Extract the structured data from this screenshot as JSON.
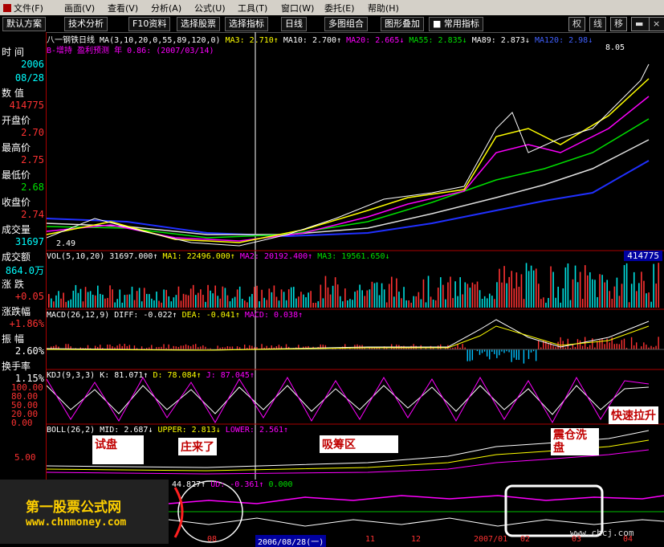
{
  "menu": [
    "文件(F)",
    "画面(V)",
    "查看(V)",
    "分析(A)",
    "公式(U)",
    "工具(T)",
    "窗口(W)",
    "委托(E)",
    "帮助(H)"
  ],
  "toolbar": {
    "buttons": [
      "默认方案",
      "技术分析",
      "F10资料",
      "选择股票",
      "选择指标",
      "日线",
      "多图组合",
      "图形叠加",
      "常用指标"
    ],
    "right": [
      "权",
      "线",
      "移"
    ]
  },
  "left_panel": {
    "time_label": "时  间",
    "year": "2006",
    "date": "08/28",
    "value_label": "数  值",
    "value": "414775",
    "open_label": "开盘价",
    "open": "2.70",
    "high_label": "最高价",
    "high": "2.75",
    "low_label": "最低价",
    "low": "2.68",
    "close_label": "收盘价",
    "close": "2.74",
    "volume_label": "成交量",
    "volume": "31697",
    "amount_label": "成交额",
    "amount": "864.0万",
    "change_label": "涨  跌",
    "change": "+0.05",
    "pct_label": "涨跌幅",
    "pct": "+1.86%",
    "amp_label": "振  幅",
    "amp": "2.60%",
    "turnover_label": "换手率",
    "turnover": "1.15%"
  },
  "price_panel": {
    "title": "八一钢铁",
    "period": "日线",
    "ma_params": "MA(3,10,20,0,55,89,120,0)",
    "ma3": "MA3: 2.710↑",
    "ma10": "MA10: 2.700↑",
    "ma20": "MA20: 2.665↓",
    "ma55": "MA55: 2.835↓",
    "ma89": "MA89: 2.873↓",
    "ma120": "MA120: 2.98↓",
    "subline": "B-增持  盈利预测",
    "subline2": "年  0.86: (2007/03/14)",
    "high_mark": "8.05",
    "low_mark": "2.49"
  },
  "vol_panel": {
    "header": "VOL(5,10,20) 31697.000↑",
    "ma1": "MA1: 22496.000↑",
    "ma2": "MA2: 20192.400↑",
    "ma3": "MA3: 19561.650↓",
    "badge": "414775"
  },
  "macd_panel": {
    "header": "MACD(26,12,9)  DIFF: -0.022↑",
    "dea": "DEA: -0.041↑",
    "macd": "MACD: 0.038↑"
  },
  "kdj_panel": {
    "header": "KDJ(9,3,3)  K: 81.071↑",
    "d": "D: 78.084↑",
    "j": "J: 87.045↑",
    "ticks": [
      "100.00",
      "80.00",
      "50.00",
      "20.00",
      "0.00"
    ]
  },
  "boll_panel": {
    "header": "BOLL(26,2)  MID: 2.687↓",
    "upper": "UPPER: 2.813↓",
    "lower": "LOWER: 2.561↑",
    "tick": "5.00"
  },
  "bottom_panel": {
    "value": "44.827↑",
    "ud": "UD: -0.361↑",
    "zero": "0.000",
    "date_tip": "2006/08/28(一)",
    "months": [
      "08",
      "11",
      "12",
      "2007/01",
      "02",
      "03",
      "04"
    ]
  },
  "annotations": [
    "试盘",
    "庄来了",
    "吸筹区",
    "震仓洗盘",
    "快速拉升"
  ],
  "brand": {
    "name": "第一股票公式网",
    "url": "www.chnmoney.com",
    "watermark": "www.chcj.com"
  },
  "colors": {
    "bg": "#000000",
    "up": "#ff3232",
    "down": "#00ffff",
    "ma3": "#ffffff",
    "ma10": "#ffff00",
    "ma20": "#ff00ff",
    "ma55": "#00ff00",
    "ma89": "#ffffff",
    "ma120": "#0000ff",
    "separator": "#aa0000"
  }
}
